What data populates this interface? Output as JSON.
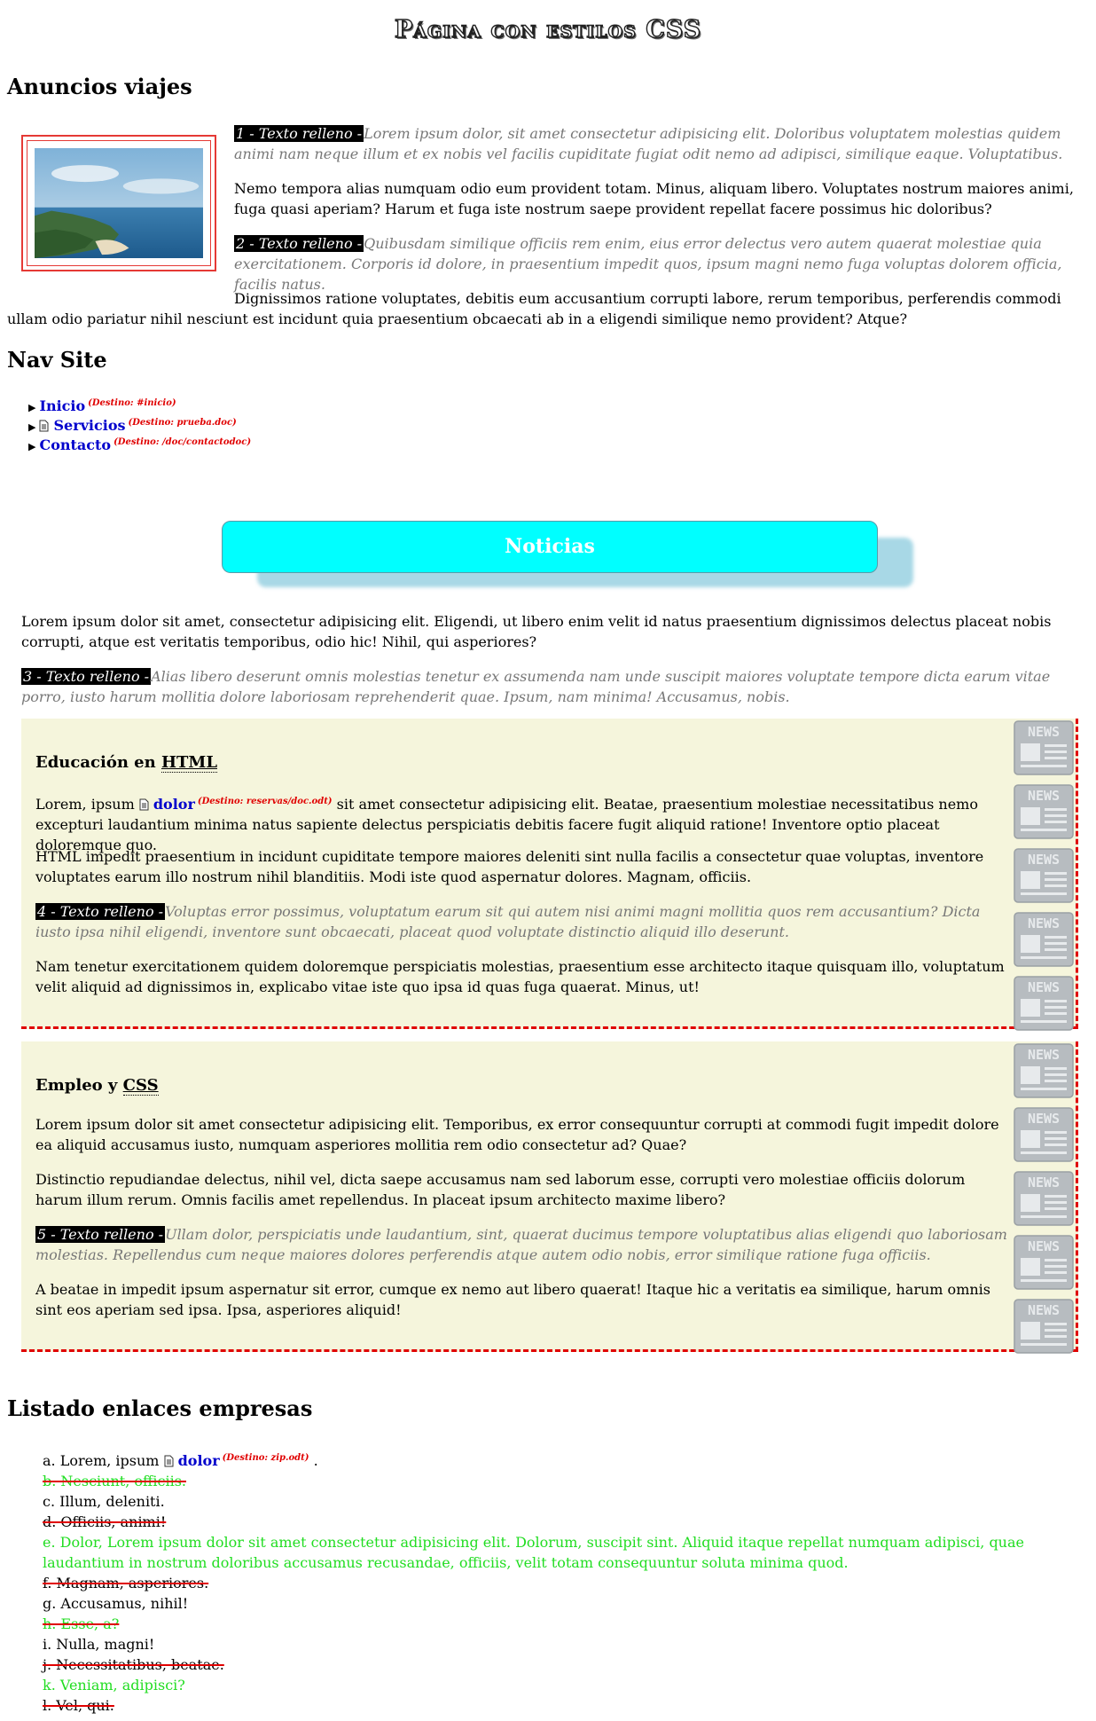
{
  "page_title": "Página con estilos CSS",
  "travel": {
    "heading": "Anuncios viajes",
    "tag1": "1 - Texto relleno -",
    "p1": "Lorem ipsum dolor, sit amet consectetur adipisicing elit. Doloribus voluptatem molestias quidem animi nam neque illum et ex nobis vel facilis cupiditate fugiat odit nemo ad adipisci, similique eaque. Voluptatibus.",
    "p2": "Nemo tempora alias numquam odio eum provident totam. Minus, aliquam libero. Voluptates nostrum maiores animi, fuga quasi aperiam? Harum et fuga iste nostrum saepe provident repellat facere possimus hic doloribus?",
    "tag2": "2 - Texto relleno -",
    "p3": "Quibusdam similique officiis rem enim, eius error delectus vero autem quaerat molestiae quia exercitationem. Corporis id dolore, in praesentium impedit quos, ipsum magni nemo fuga voluptas dolorem officia, facilis natus.",
    "p4": "Dignissimos ratione voluptates, debitis eum accusantium corrupti labore, rerum temporibus, perferendis commodi ullam odio pariatur nihil nesciunt est incidunt quia praesentium obcaecati ab in a eligendi similique nemo provident? Atque?"
  },
  "nav": {
    "heading": "Nav Site",
    "items": [
      {
        "label": "Inicio",
        "dest": "(Destino: #inicio)",
        "doc": false
      },
      {
        "label": "Servicios",
        "dest": "(Destino: prueba.doc)",
        "doc": true
      },
      {
        "label": "Contacto",
        "dest": "(Destino: /doc/contactodoc)",
        "doc": false
      }
    ]
  },
  "news": {
    "title": "Noticias",
    "intro": "Lorem ipsum dolor sit amet, consectetur adipisicing elit. Eligendi, ut libero enim velit id natus praesentium dignissimos delectus placeat nobis corrupti, atque est veritatis temporibus, odio hic! Nihil, qui asperiores?",
    "tag3": "3 - Texto relleno -",
    "p3": "Alias libero deserunt omnis molestias tenetur ex assumenda nam unde suscipit maiores voluptate tempore dicta earum vitae porro, iusto harum mollitia dolore laboriosam reprehenderit quae. Ipsum, nam minima! Accusamus, nobis.",
    "icon_label": "NEWS",
    "article1": {
      "title_pre": "Educación en",
      "title_abbr": "HTML",
      "p1_pre": "Lorem, ipsum",
      "p1_link": "dolor",
      "p1_dest": "(Destino: reservas/doc.odt)",
      "p1_post": "sit amet consectetur adipisicing elit. Beatae, praesentium molestiae necessitatibus nemo excepturi laudantium minima natus sapiente delectus perspiciatis debitis facere fugit aliquid ratione! Inventore optio placeat doloremque quo.",
      "p2": "HTML impedit praesentium in incidunt cupiditate tempore maiores deleniti sint nulla facilis a consectetur quae voluptas, inventore voluptates earum illo nostrum nihil blanditiis. Modi iste quod aspernatur dolores. Magnam, officiis.",
      "tag": "4 - Texto relleno -",
      "p3": "Voluptas error possimus, voluptatum earum sit qui autem nisi animi magni mollitia quos rem accusantium? Dicta iusto ipsa nihil eligendi, inventore sunt obcaecati, placeat quod voluptate distinctio aliquid illo deserunt.",
      "p4": "Nam tenetur exercitationem quidem doloremque perspiciatis molestias, praesentium esse architecto itaque quisquam illo, voluptatum velit aliquid ad dignissimos in, explicabo vitae iste quo ipsa id quas fuga quaerat. Minus, ut!"
    },
    "article2": {
      "title_pre": "Empleo y",
      "title_abbr": "CSS",
      "p1": "Lorem ipsum dolor sit amet consectetur adipisicing elit. Temporibus, ex error consequuntur corrupti at commodi fugit impedit dolore ea aliquid accusamus iusto, numquam asperiores mollitia rem odio consectetur ad? Quae?",
      "p2": "Distinctio repudiandae delectus, nihil vel, dicta saepe accusamus nam sed laborum esse, corrupti vero molestiae officiis dolorum harum illum rerum. Omnis facilis amet repellendus. In placeat ipsum architecto maxime libero?",
      "tag": "5 - Texto relleno -",
      "p3": "Ullam dolor, perspiciatis unde laudantium, sint, quaerat ducimus tempore voluptatibus alias eligendi quo laboriosam molestias. Repellendus cum neque maiores dolores perferendis atque autem odio nobis, error similique ratione fuga officiis.",
      "p4": "A beatae in impedit ipsum aspernatur sit error, cumque ex nemo aut libero quaerat! Itaque hic a veritatis ea similique, harum omnis sint eos aperiam sed ipsa. Ipsa, asperiores aliquid!"
    }
  },
  "companies": {
    "heading": "Listado enlaces empresas",
    "first": {
      "pre": "a. Lorem, ipsum",
      "link": "dolor",
      "dest": "(Destino: zip.odt)",
      "post": "."
    },
    "items": [
      {
        "text": "b. Nesciunt, officiis.",
        "style": "green-strike"
      },
      {
        "text": "c. Illum, deleniti.",
        "style": "plain"
      },
      {
        "text": "d. Officiis, animi!",
        "style": "strike"
      },
      {
        "text": "e. Dolor, Lorem ipsum dolor sit amet consectetur adipisicing elit. Dolorum, suscipit sint. Aliquid itaque repellat numquam adipisci, quae laudantium in nostrum doloribus accusamus recusandae, officiis, velit totam consequuntur soluta minima quod.",
        "style": "green"
      },
      {
        "text": "f. Magnam, asperiores.",
        "style": "strike"
      },
      {
        "text": "g. Accusamus, nihil!",
        "style": "plain"
      },
      {
        "text": "h. Esse, a?",
        "style": "green-strike"
      },
      {
        "text": "i. Nulla, magni!",
        "style": "plain"
      },
      {
        "text": "j. Necessitatibus, beatae.",
        "style": "strike"
      },
      {
        "text": "k. Veniam, adipisci?",
        "style": "green"
      },
      {
        "text": "l. Vel, qui.",
        "style": "strike"
      }
    ]
  }
}
